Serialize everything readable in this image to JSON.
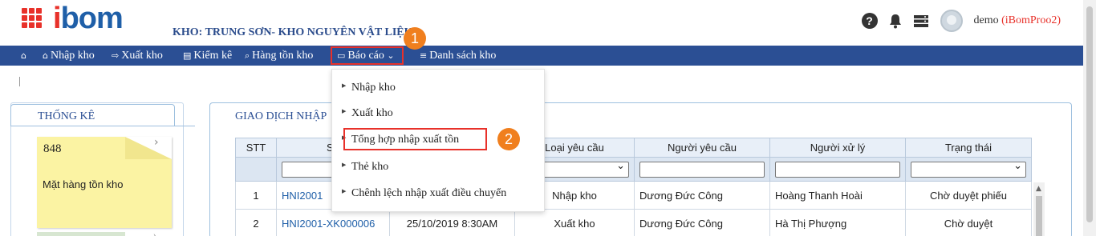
{
  "header": {
    "logo_i": "i",
    "logo_bom": "bom",
    "warehouse": "KHO: TRUNG SƠN- KHO NGUYÊN VẬT LIỆU",
    "user_name": "demo",
    "user_org": "(iBomProo2)"
  },
  "nav": {
    "home_icon": "⌂",
    "items": [
      {
        "icon": "⌂",
        "label": "Nhập kho"
      },
      {
        "icon": "⇨",
        "label": "Xuất kho"
      },
      {
        "icon": "▤",
        "label": "Kiểm kê"
      },
      {
        "icon": "⌕",
        "label": "Hàng tồn kho"
      },
      {
        "icon": "▭",
        "label": "Báo cáo",
        "caret": "⌄"
      },
      {
        "icon": "≡",
        "label": "Danh sách kho"
      }
    ]
  },
  "badges": {
    "first": "1",
    "second": "2"
  },
  "report_menu": [
    "Nhập kho",
    "Xuất kho",
    "Tổng hợp nhập xuất tồn",
    "Thẻ kho",
    "Chênh lệch nhập xuất điều chuyển"
  ],
  "stats": {
    "title": "THỐNG KÊ",
    "card_value": "848",
    "card_label": "Mặt hàng tồn kho"
  },
  "transactions": {
    "title": "GIAO DỊCH NHẬP",
    "columns": [
      "STT",
      "Số",
      "",
      "Loại yêu cầu",
      "Người yêu cầu",
      "Người xử lý",
      "Trạng thái"
    ],
    "rows": [
      {
        "stt": "1",
        "number": "HNI2001",
        "date": "",
        "type": "Nhập kho",
        "requester": "Dương Đức Công",
        "handler": "Hoàng Thanh Hoài",
        "status": "Chờ duyệt phiếu"
      },
      {
        "stt": "2",
        "number": "HNI2001-XK000006",
        "date": "25/10/2019 8:30AM",
        "type": "Xuất kho",
        "requester": "Dương Đức Công",
        "handler": "Hà Thị Phượng",
        "status": "Chờ duyệt"
      }
    ]
  },
  "colors": {
    "brand_red": "#e8312a",
    "nav_blue": "#2b4f94",
    "badge_orange": "#f07f1e"
  }
}
